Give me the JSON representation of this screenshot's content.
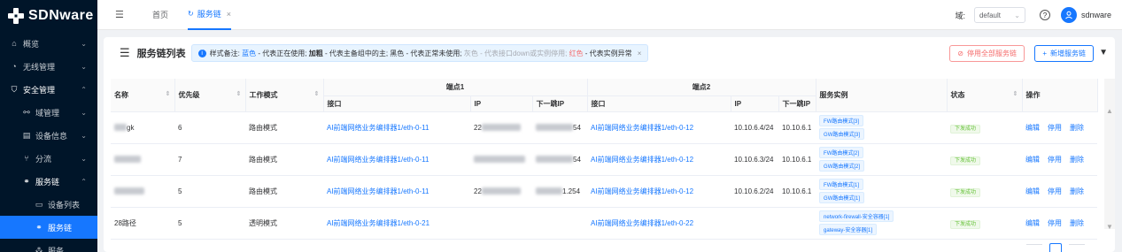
{
  "brand": {
    "name": "SDNware"
  },
  "sidebar": {
    "items": [
      {
        "label": "概览",
        "icon": "home-icon",
        "level": 1,
        "chevron": "down"
      },
      {
        "label": "无线管理",
        "icon": "wifi-icon",
        "level": 1,
        "chevron": "down"
      },
      {
        "label": "安全管理",
        "icon": "shield-icon",
        "level": 1,
        "chevron": "up",
        "strong": true
      },
      {
        "label": "域管理",
        "icon": "tree-icon",
        "level": 2,
        "chevron": "down"
      },
      {
        "label": "设备信息",
        "icon": "book-icon",
        "level": 2,
        "chevron": "down"
      },
      {
        "label": "分流",
        "icon": "split-icon",
        "level": 2,
        "chevron": "down"
      },
      {
        "label": "服务链",
        "icon": "link-icon",
        "level": 2,
        "chevron": "up",
        "strong": true
      },
      {
        "label": "设备列表",
        "icon": "monitor-icon",
        "level": 3
      },
      {
        "label": "服务链",
        "icon": "link-icon",
        "level": 3,
        "active": true
      },
      {
        "label": "服务",
        "icon": "cluster-icon",
        "level": 3
      }
    ]
  },
  "header": {
    "tabs": [
      {
        "label": "首页",
        "active": false
      },
      {
        "label": "服务链",
        "active": true
      }
    ],
    "domain_label": "域:",
    "domain_value": "default",
    "help": "?",
    "user": "sdnware"
  },
  "card": {
    "title": "服务链列表",
    "alert": {
      "prefix": "样式备注:",
      "blue_word": "蓝色",
      "blue_desc": "- 代表正在使用;",
      "bold_word": "加粗",
      "bold_desc": "- 代表主备组中的主;",
      "black_desc": "黑色 - 代表正常未使用;",
      "gray_desc": "灰色 - 代表接口down或实例停用;",
      "red_word": "红色",
      "red_desc": "- 代表实例异常",
      "close": "×"
    },
    "stop_all_label": "停用全部服务链",
    "add_label": "新增服务链"
  },
  "table": {
    "headers": {
      "name": "名称",
      "priority": "优先级",
      "mode": "工作模式",
      "endpoint1": "端点1",
      "endpoint2": "端点2",
      "iface": "接口",
      "ip": "IP",
      "nexthop": "下一跳IP",
      "instances": "服务实例",
      "status": "状态",
      "ops": "操作"
    },
    "rows": [
      {
        "name": "gk",
        "priority": "6",
        "mode": "路由模式",
        "e1_iface": "AI前端网络业务编排器1/eth-0-11",
        "e1_ip": "22",
        "e1_nexthop": "54",
        "e2_iface": "AI前端网络业务编排器1/eth-0-12",
        "e2_ip": "10.10.6.4/24",
        "e2_nexthop": "10.10.6.1",
        "instances": [
          "FW路由模式[3]",
          "GW路由模式[3]"
        ],
        "status": "下发成功",
        "ops": [
          "编辑",
          "停用",
          "删除"
        ]
      },
      {
        "name": "",
        "priority": "7",
        "mode": "路由模式",
        "e1_iface": "AI前端网络业务编排器1/eth-0-11",
        "e1_ip": "",
        "e1_nexthop": "54",
        "e2_iface": "AI前端网络业务编排器1/eth-0-12",
        "e2_ip": "10.10.6.3/24",
        "e2_nexthop": "10.10.6.1",
        "instances": [
          "FW路由模式[2]",
          "GW路由模式[2]"
        ],
        "status": "下发成功",
        "ops": [
          "编辑",
          "停用",
          "删除"
        ]
      },
      {
        "name": "",
        "priority": "5",
        "mode": "路由模式",
        "e1_iface": "AI前端网络业务编排器1/eth-0-11",
        "e1_ip": "22",
        "e1_nexthop": "1.254",
        "e2_iface": "AI前端网络业务编排器1/eth-0-12",
        "e2_ip": "10.10.6.2/24",
        "e2_nexthop": "10.10.6.1",
        "instances": [
          "FW路由模式[1]",
          "GW路由模式[1]"
        ],
        "status": "下发成功",
        "ops": [
          "编辑",
          "停用",
          "删除"
        ]
      },
      {
        "name": "28路径",
        "priority": "5",
        "mode": "透明模式",
        "e1_iface": "AI前端网络业务编排器1/eth-0-21",
        "e1_ip": "",
        "e1_nexthop": "",
        "e2_iface": "AI前端网络业务编排器1/eth-0-22",
        "e2_ip": "",
        "e2_nexthop": "",
        "instances": [
          "network-firewall-安全容器[1]",
          "gateway-安全容器[1]"
        ],
        "status": "下发成功",
        "ops": [
          "编辑",
          "停用",
          "删除"
        ]
      }
    ]
  }
}
